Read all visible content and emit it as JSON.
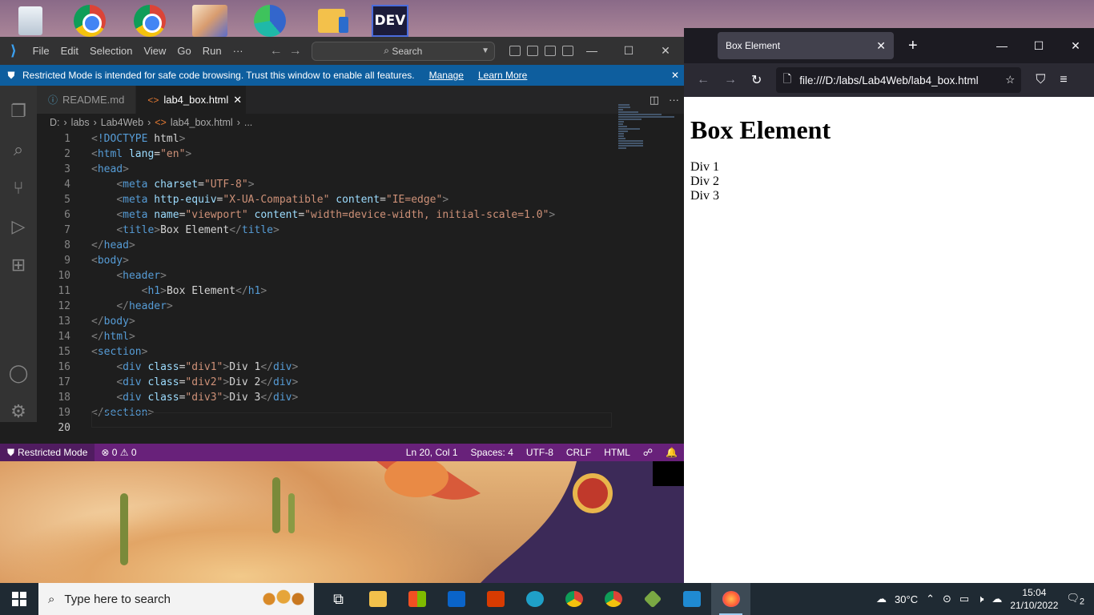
{
  "desktop": {
    "icons": [
      "recycle-bin-icon",
      "chrome-icon",
      "chrome-profile-icon",
      "anime-app-icon",
      "edge-icon",
      "folder-music-icon",
      "dev-app-icon"
    ],
    "dev_label": "DEV"
  },
  "vscode": {
    "menu": [
      "File",
      "Edit",
      "Selection",
      "View",
      "Go",
      "Run",
      "···"
    ],
    "search_label": "Search",
    "banner": {
      "text": "Restricted Mode is intended for safe code browsing. Trust this window to enable all features.",
      "manage": "Manage",
      "learn_more": "Learn More"
    },
    "tabs": [
      {
        "label": "README.md",
        "icon": "ⓘ"
      },
      {
        "label": "lab4_box.html",
        "icon": "<>"
      }
    ],
    "breadcrumb": [
      "D:",
      "labs",
      "Lab4Web",
      "lab4_box.html",
      "..."
    ],
    "code_lines": [
      "<!DOCTYPE html>",
      "<html lang=\"en\">",
      "<head>",
      "    <meta charset=\"UTF-8\">",
      "    <meta http-equiv=\"X-UA-Compatible\" content=\"IE=edge\">",
      "    <meta name=\"viewport\" content=\"width=device-width, initial-scale=1.0\">",
      "    <title>Box Element</title>",
      "</head>",
      "<body>",
      "    <header>",
      "        <h1>Box Element</h1>",
      "    </header>",
      "</body>",
      "</html>",
      "<section>",
      "    <div class=\"div1\">Div 1</div>",
      "    <div class=\"div2\">Div 2</div>",
      "    <div class=\"div3\">Div 3</div>",
      "</section>",
      ""
    ],
    "status": {
      "restricted": "Restricted Mode",
      "problems": "⊗ 0 ⚠ 0",
      "position": "Ln 20, Col 1",
      "spaces": "Spaces: 4",
      "encoding": "UTF-8",
      "eol": "CRLF",
      "language": "HTML"
    }
  },
  "firefox": {
    "tab_title": "Box Element",
    "url": "file:///D:/labs/Lab4Web/lab4_box.html",
    "page": {
      "heading": "Box Element",
      "divs": [
        "Div 1",
        "Div 2",
        "Div 3"
      ]
    }
  },
  "taskbar": {
    "search_placeholder": "Type here to search",
    "weather": "30°C",
    "time": "15:04",
    "date": "21/10/2022",
    "notification_count": "2"
  }
}
